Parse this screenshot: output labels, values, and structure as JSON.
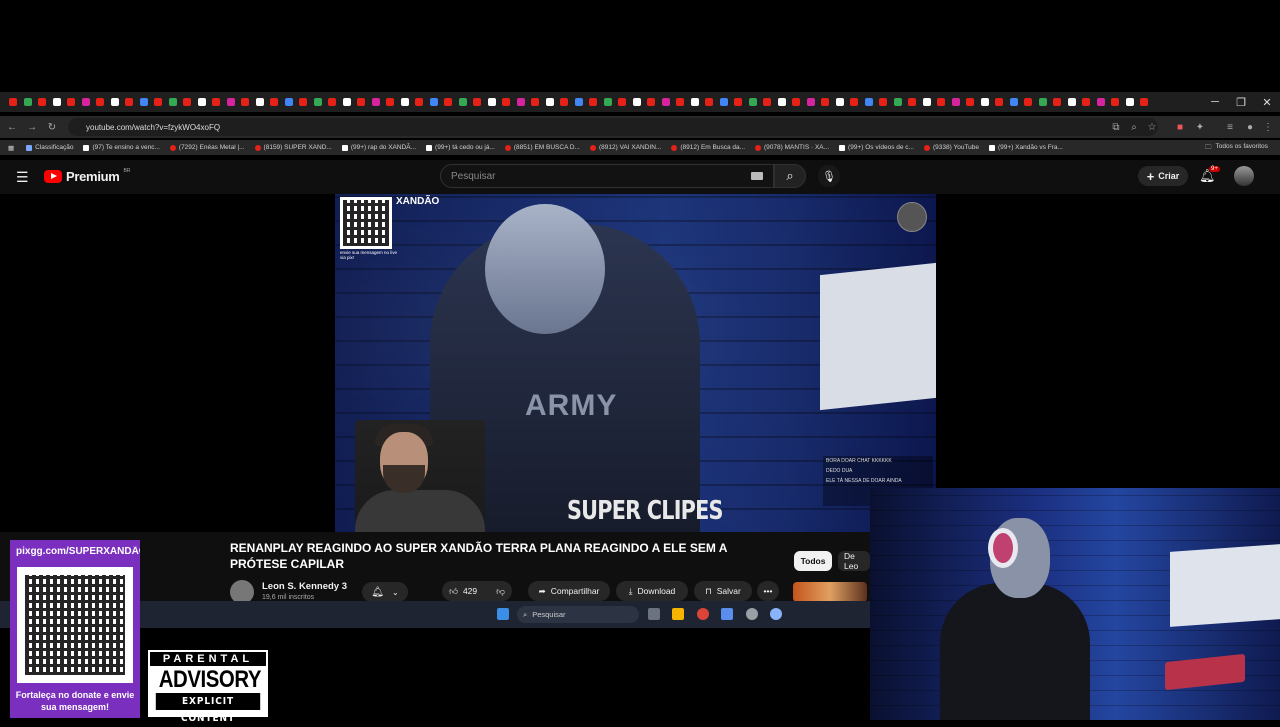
{
  "browser": {
    "url": "youtube.com/watch?v=fzykWO4xoFQ",
    "bookmarks": [
      {
        "label": "Classificação",
        "icon": "folder-icon"
      },
      {
        "label": "(97) Te ensino a venc...",
        "icon": "tiktok-icon"
      },
      {
        "label": "(7292) Enéas Metal |...",
        "icon": "youtube-icon"
      },
      {
        "label": "(8159) SUPER XAND...",
        "icon": "youtube-icon"
      },
      {
        "label": "(99+) rap do XANDÃ...",
        "icon": "tiktok-icon"
      },
      {
        "label": "(99+) tá cedo ou já...",
        "icon": "tiktok-icon"
      },
      {
        "label": "(8851) EM BUSCA D...",
        "icon": "youtube-icon"
      },
      {
        "label": "(8912) VAI XANDIN...",
        "icon": "youtube-icon"
      },
      {
        "label": "(8912) Em Busca da...",
        "icon": "youtube-icon"
      },
      {
        "label": "(9078) MANTIS · XA...",
        "icon": "youtube-icon"
      },
      {
        "label": "(99+) Os vídeos de c...",
        "icon": "tiktok-icon"
      },
      {
        "label": "(9338) YouTube",
        "icon": "youtube-icon"
      },
      {
        "label": "(99+) Xandão vs Fra...",
        "icon": "tiktok-icon"
      }
    ],
    "all_bookmarks": "Todos os favoritos"
  },
  "youtube": {
    "logo_text": "Premium",
    "logo_region": "BR",
    "search_placeholder": "Pesquisar",
    "create_label": "Criar",
    "notif_count": "9+"
  },
  "video": {
    "overlay_title": "XANDÃO",
    "overlay_qr_caption": "envie sua mensagem no live via pix!",
    "overlay_clip": "SUPER CLIPES",
    "chat_lines": [
      "BORA DOAR CHAT KKKKKK",
      "DEDO DUA",
      "ELE TÁ NESSA DE DOAR AINDA"
    ]
  },
  "watch": {
    "title": "RENANPLAY REAGINDO AO SUPER XANDÃO TERRA PLANA REAGINDO A ELE SEM A PRÓTESE CAPILAR",
    "channel": "Leon S. Kennedy 3",
    "subscribers": "19,6 mil inscritos",
    "likes": "429",
    "share_label": "Compartilhar",
    "download_label": "Download",
    "save_label": "Salvar",
    "chips": [
      "Todos",
      "De Leo"
    ]
  },
  "taskbar": {
    "search_placeholder": "Pesquisar"
  },
  "qr_panel": {
    "url": "pixgg.com/SUPERXANDÃO",
    "cta": "Fortaleça no donate e envie sua mensagem!"
  },
  "parental_advisory": {
    "line1": "PARENTAL",
    "line2": "ADVISORY",
    "line3": "EXPLICIT CONTENT"
  },
  "colors": {
    "youtube_red": "#ff0000",
    "qr_panel_purple": "#7b2fbf",
    "background": "#0f0f0f"
  }
}
